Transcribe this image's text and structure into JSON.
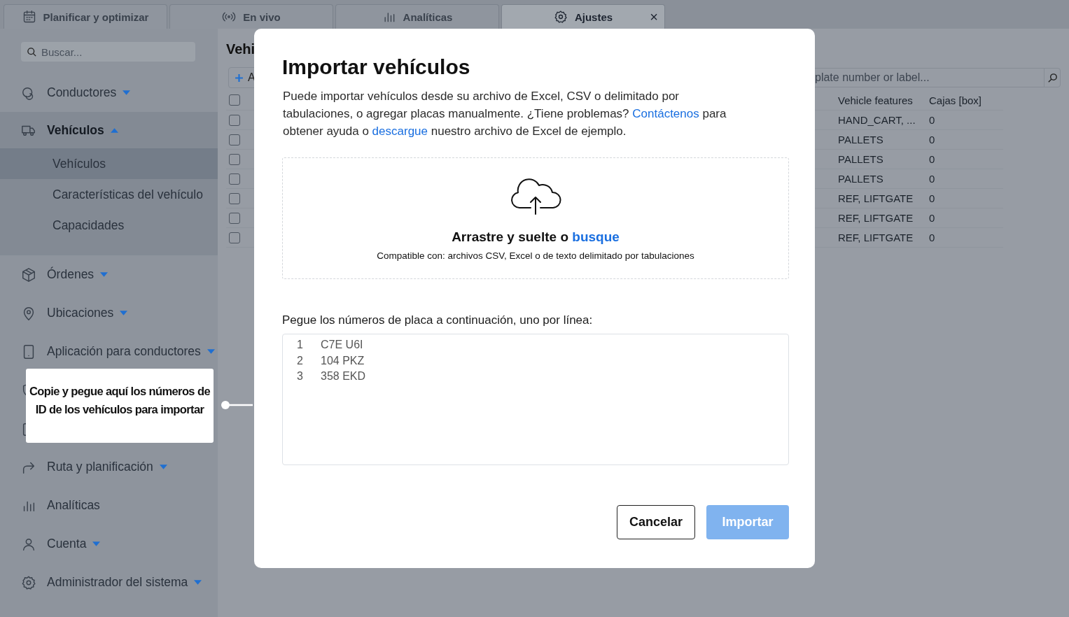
{
  "tabs": [
    {
      "label": "Planificar y optimizar",
      "kind": "calendar",
      "selected": false
    },
    {
      "label": "En vivo",
      "kind": "broadcast",
      "selected": false
    },
    {
      "label": "Analíticas",
      "kind": "bars",
      "selected": false
    },
    {
      "label": "Ajustes",
      "kind": "gear",
      "selected": true,
      "close": "×"
    }
  ],
  "sidebar": {
    "search": {
      "placeholder": "Buscar..."
    },
    "items": [
      {
        "label": "Conductores",
        "kind": "steering",
        "expanded": false
      },
      {
        "label": "Vehículos",
        "kind": "truck",
        "expanded": true,
        "children": [
          {
            "label": "Vehículos",
            "selected": true
          },
          {
            "label": "Características del vehículo",
            "selected": false
          },
          {
            "label": "Capacidades",
            "selected": false
          }
        ]
      },
      {
        "label": "Órdenes",
        "kind": "box",
        "expanded": false
      },
      {
        "label": "Ubicaciones",
        "kind": "pin",
        "expanded": false
      },
      {
        "label": "Aplicación para conductores",
        "kind": "phone",
        "expanded": false
      },
      {
        "kind": "shield"
      },
      {
        "kind": "clipboard"
      },
      {
        "label": "Ruta y planificación",
        "kind": "route",
        "expanded": false
      },
      {
        "label": "Analíticas",
        "kind": "bars"
      },
      {
        "label": "Cuenta",
        "kind": "user",
        "expanded": false
      },
      {
        "label": "Administrador del sistema",
        "kind": "gear",
        "expanded": false
      }
    ]
  },
  "page": {
    "title": "Vehi",
    "add_button": "A",
    "search": {
      "placeholder": "plate number or label..."
    },
    "table": {
      "columns": [
        "Vehicle features",
        "Cajas [box]"
      ],
      "rows": [
        {
          "checked": false,
          "cells": [
            "HAND_CART, ...",
            "0"
          ]
        },
        {
          "checked": false,
          "cells": [
            "PALLETS",
            "0"
          ]
        },
        {
          "checked": false,
          "cells": [
            "PALLETS",
            "0"
          ]
        },
        {
          "checked": false,
          "cells": [
            "PALLETS",
            "0"
          ]
        },
        {
          "checked": false,
          "cells": [
            "REF, LIFTGATE",
            "0"
          ]
        },
        {
          "checked": false,
          "cells": [
            "REF, LIFTGATE",
            "0"
          ]
        },
        {
          "checked": false,
          "cells": [
            "REF, LIFTGATE",
            "0"
          ]
        }
      ]
    },
    "header_checked": false
  },
  "modal": {
    "title": "Importar vehículos",
    "description": [
      {
        "kind": "text",
        "text": "Puede importar vehículos desde su archivo de Excel, CSV o delimitado por tabulaciones, o agregar placas manualmente. ¿Tiene problemas? "
      },
      {
        "kind": "link",
        "text": "Contáctenos"
      },
      {
        "kind": "text",
        "text": " para obtener ayuda o "
      },
      {
        "kind": "link",
        "text": "descargue"
      },
      {
        "kind": "text",
        "text": " nuestro archivo de Excel de ejemplo."
      }
    ],
    "dropzone": {
      "heading": "Arrastre y suelte o ",
      "link": "busque",
      "hint": "Compatible con: archivos CSV, Excel o de texto delimitado por tabulaciones"
    },
    "paste_label": "Pegue los números de placa a continuación, uno por línea:",
    "lines": [
      {
        "number": "1",
        "text": "C7E U6I"
      },
      {
        "number": "2",
        "text": "104 PKZ"
      },
      {
        "number": "3",
        "text": "358 EKD"
      }
    ],
    "buttons": [
      {
        "label": "Cancelar",
        "kind": "secondary",
        "disabled": false
      },
      {
        "label": "Importar",
        "kind": "primary",
        "disabled": true
      }
    ]
  },
  "callout": {
    "text": "Copie y pegue aquí los números de ID de los vehículos para importar"
  }
}
